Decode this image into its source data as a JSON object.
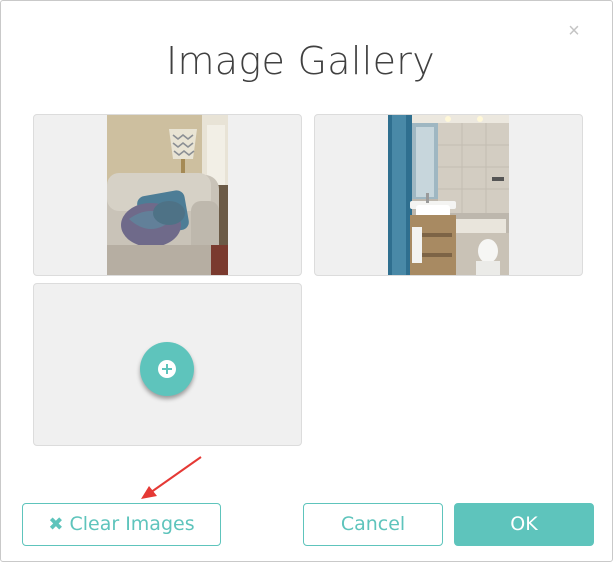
{
  "dialog": {
    "title": "Image Gallery",
    "close_icon": "close-icon",
    "close_glyph": "×"
  },
  "gallery": {
    "images": [
      {
        "subject": "living room armchair with cushions and lamp"
      },
      {
        "subject": "bathroom with vanity sink and mirror"
      }
    ],
    "add_button_icon": "plus-circle-icon"
  },
  "footer": {
    "clear_label": "Clear Images",
    "clear_icon": "x-icon",
    "clear_glyph": "✖",
    "cancel_label": "Cancel",
    "ok_label": "OK"
  },
  "colors": {
    "accent": "#5ec4bc",
    "tile_bg": "#f0f0f0",
    "annotation_arrow": "#e53935"
  }
}
